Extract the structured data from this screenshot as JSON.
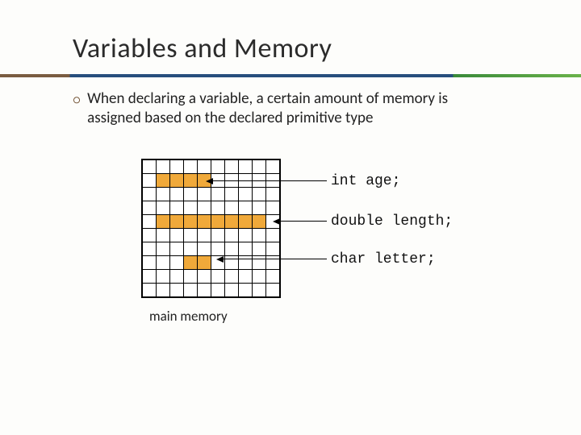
{
  "title": "Variables and Memory",
  "bullet": {
    "glyph": "၀",
    "text": "When declaring a variable, a certain amount of memory is assigned based on the declared primitive type"
  },
  "memory": {
    "rows": 10,
    "cols": 10,
    "filled": [
      [
        1,
        1
      ],
      [
        1,
        2
      ],
      [
        1,
        3
      ],
      [
        1,
        4
      ],
      [
        4,
        1
      ],
      [
        4,
        2
      ],
      [
        4,
        3
      ],
      [
        4,
        4
      ],
      [
        4,
        5
      ],
      [
        4,
        6
      ],
      [
        4,
        7
      ],
      [
        4,
        8
      ],
      [
        7,
        3
      ],
      [
        7,
        4
      ]
    ],
    "caption": "main memory"
  },
  "labels": {
    "int": "int age;",
    "double": "double length;",
    "char": "char letter;"
  }
}
